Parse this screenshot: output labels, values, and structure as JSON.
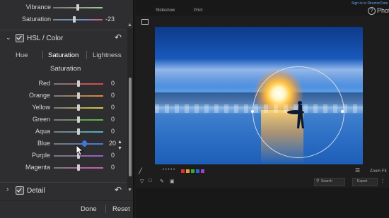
{
  "top_sliders": [
    {
      "label": "Vibrance",
      "value": "",
      "knob": 0.5,
      "gradient": "linear-gradient(90deg,#777,#a4c6a0)"
    },
    {
      "label": "Saturation",
      "value": "-23",
      "knob": 0.42,
      "gradient": "linear-gradient(90deg,#888,#5a9bd5,#d55a8e)"
    }
  ],
  "hsl": {
    "title": "HSL / Color",
    "tabs": [
      "Hue",
      "Saturation",
      "Lightness"
    ],
    "active_tab": "Saturation",
    "subtitle": "Saturation",
    "rows": [
      {
        "label": "Red",
        "value": "0",
        "knob": 0.5,
        "color": "#d94a4a",
        "value_color": "#d8d8d8"
      },
      {
        "label": "Orange",
        "value": "0",
        "knob": 0.5,
        "color": "#e08a3c",
        "value_color": "#d8d8d8"
      },
      {
        "label": "Yellow",
        "value": "0",
        "knob": 0.5,
        "color": "#d9cc3f",
        "value_color": "#d8d8d8"
      },
      {
        "label": "Green",
        "value": "0",
        "knob": 0.5,
        "color": "#5fb64f",
        "value_color": "#d8d8d8"
      },
      {
        "label": "Aqua",
        "value": "0",
        "knob": 0.5,
        "color": "#4ab7c4",
        "value_color": "#d8d8d8"
      },
      {
        "label": "Blue",
        "value": "20",
        "knob": 0.6,
        "color": "#4a77d9",
        "value_color": "#d8d8d8"
      },
      {
        "label": "Purple",
        "value": "0",
        "knob": 0.5,
        "color": "#9c5ad1",
        "value_color": "#d8d8d8"
      },
      {
        "label": "Magenta",
        "value": "0",
        "knob": 0.5,
        "color": "#d45ab5",
        "value_color": "#d8d8d8"
      }
    ]
  },
  "detail": {
    "title": "Detail"
  },
  "footer": {
    "done": "Done",
    "reset": "Reset"
  },
  "topbar": {
    "menu": [
      "Slideshow",
      "Print"
    ],
    "signin": "Sign In to DirectorZone",
    "app": "Photo"
  },
  "bottombar": {
    "search": "Search",
    "export": "Export",
    "zoom": "Zoom",
    "fit": "Fit",
    "dots": "• • • • •",
    "color_labels": [
      "#e03030",
      "#e0a030",
      "#30b030",
      "#3060e0",
      "#a040d0"
    ]
  }
}
